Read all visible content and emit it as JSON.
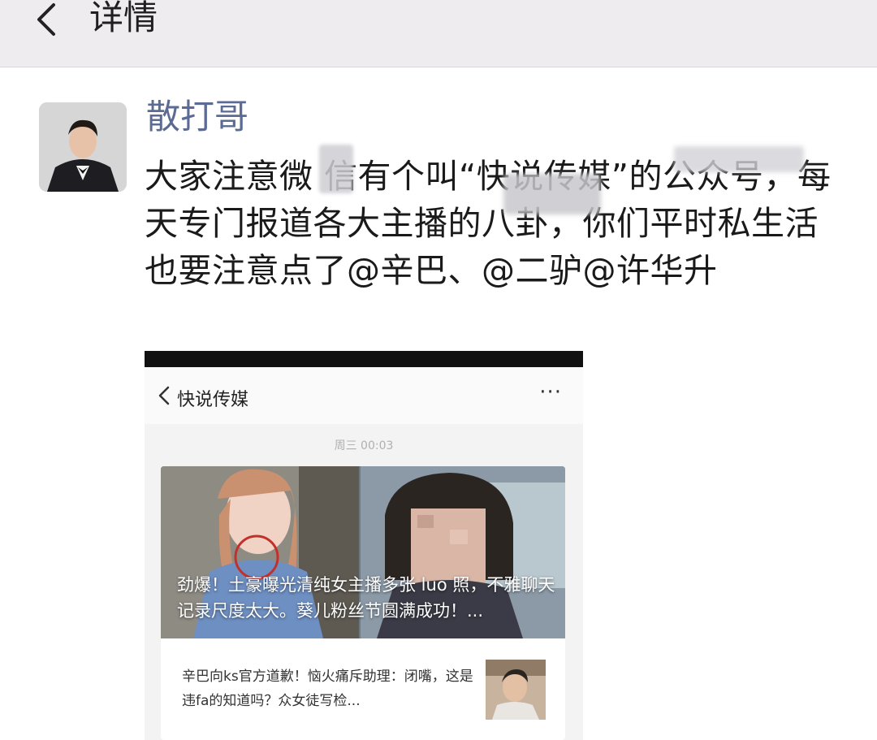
{
  "header": {
    "title": "详情"
  },
  "post": {
    "author": "散打哥",
    "text": "大家注意微 信有个叫“快说传媒”的公众号，每天专门报道各大主播的八卦，你们平时私生活也要注意点了@辛巴、@二驴@许华升"
  },
  "screenshot": {
    "nav_title": "快说传媒",
    "more": "···",
    "time": "周三 00:03",
    "card": {
      "headline": "劲爆！土豪曝光清纯女主播多张 luo 照，不雅聊天记录尺度太大。葵儿粉丝节圆满成功！...",
      "sub_title": "辛巴向ks官方道歉！恼火痛斥助理：闭嘴，这是违fa的知道吗？众女徒写检..."
    }
  }
}
